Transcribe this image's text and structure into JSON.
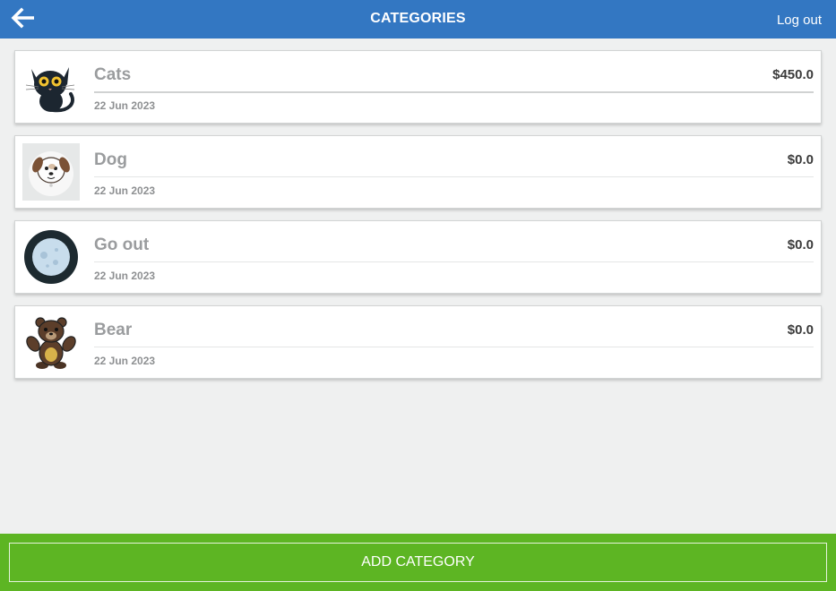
{
  "header": {
    "title": "CATEGORIES",
    "logout_label": "Log out",
    "back_icon": "arrow-left-icon",
    "color": "#3377c2"
  },
  "categories": [
    {
      "name": "Cats",
      "amount": "$450.0",
      "date": "22 Jun 2023",
      "icon": "cat-icon"
    },
    {
      "name": "Dog",
      "amount": "$0.0",
      "date": "22 Jun 2023",
      "icon": "dog-icon"
    },
    {
      "name": "Go out",
      "amount": "$0.0",
      "date": "22 Jun 2023",
      "icon": "moon-icon"
    },
    {
      "name": "Bear",
      "amount": "$0.0",
      "date": "22 Jun 2023",
      "icon": "bear-icon"
    }
  ],
  "footer": {
    "add_label": "ADD CATEGORY",
    "color": "#5db523"
  }
}
